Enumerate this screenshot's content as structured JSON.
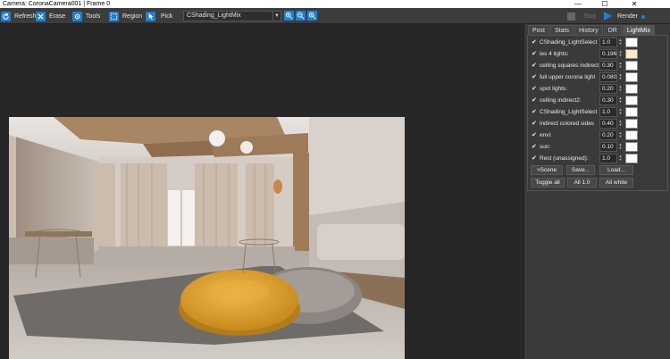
{
  "window": {
    "title": "Camera: CoronaCamera001 | Frame 0",
    "minimize": "—",
    "maximize": "☐",
    "close": "✕"
  },
  "toolbar": {
    "refresh": "Refresh",
    "erase": "Erase",
    "tools": "Tools",
    "region": "Region",
    "pick": "Pick",
    "lightmix_select": "CShading_LightMix",
    "stop": "Stop",
    "render": "Render"
  },
  "panel": {
    "tabs": [
      "Post",
      "Stats",
      "History",
      "DR",
      "LightMix"
    ],
    "active_tab": "LightMix",
    "lights": [
      {
        "name": "CShading_LightSelect",
        "value": "1.0",
        "color": "#ffffff"
      },
      {
        "name": "ies 4 lights:",
        "value": "0.196",
        "color": "#fde9c8"
      },
      {
        "name": "ceiling squares indirect",
        "value": "0.30",
        "color": "#ffffff"
      },
      {
        "name": "full upper corona light",
        "value": "0.080",
        "color": "#ffffff"
      },
      {
        "name": "spot lights:",
        "value": "0.20",
        "color": "#ffffff"
      },
      {
        "name": "ceiling indirect2:",
        "value": "0.30",
        "color": "#ffffff"
      },
      {
        "name": "CShading_LightSelect",
        "value": "1.0",
        "color": "#ffffff"
      },
      {
        "name": "indirect colored sides",
        "value": "0.40",
        "color": "#ffffff"
      },
      {
        "name": "envi:",
        "value": "0.20",
        "color": "#ffffff"
      },
      {
        "name": "sun:",
        "value": "0.10",
        "color": "#ffffff"
      },
      {
        "name": "Rest (unassigned):",
        "value": "1.0",
        "color": "#ffffff"
      }
    ],
    "buttons": {
      "to_scene": ">Scene",
      "save": "Save...",
      "load": "Load...",
      "toggle_all": "Toggle all",
      "all_one": "All 1.0",
      "all_white": "All white"
    }
  },
  "colors": {
    "accent": "#1f7fd4",
    "panel_bg": "#3a3a3a",
    "viewport_bg": "#272727"
  }
}
